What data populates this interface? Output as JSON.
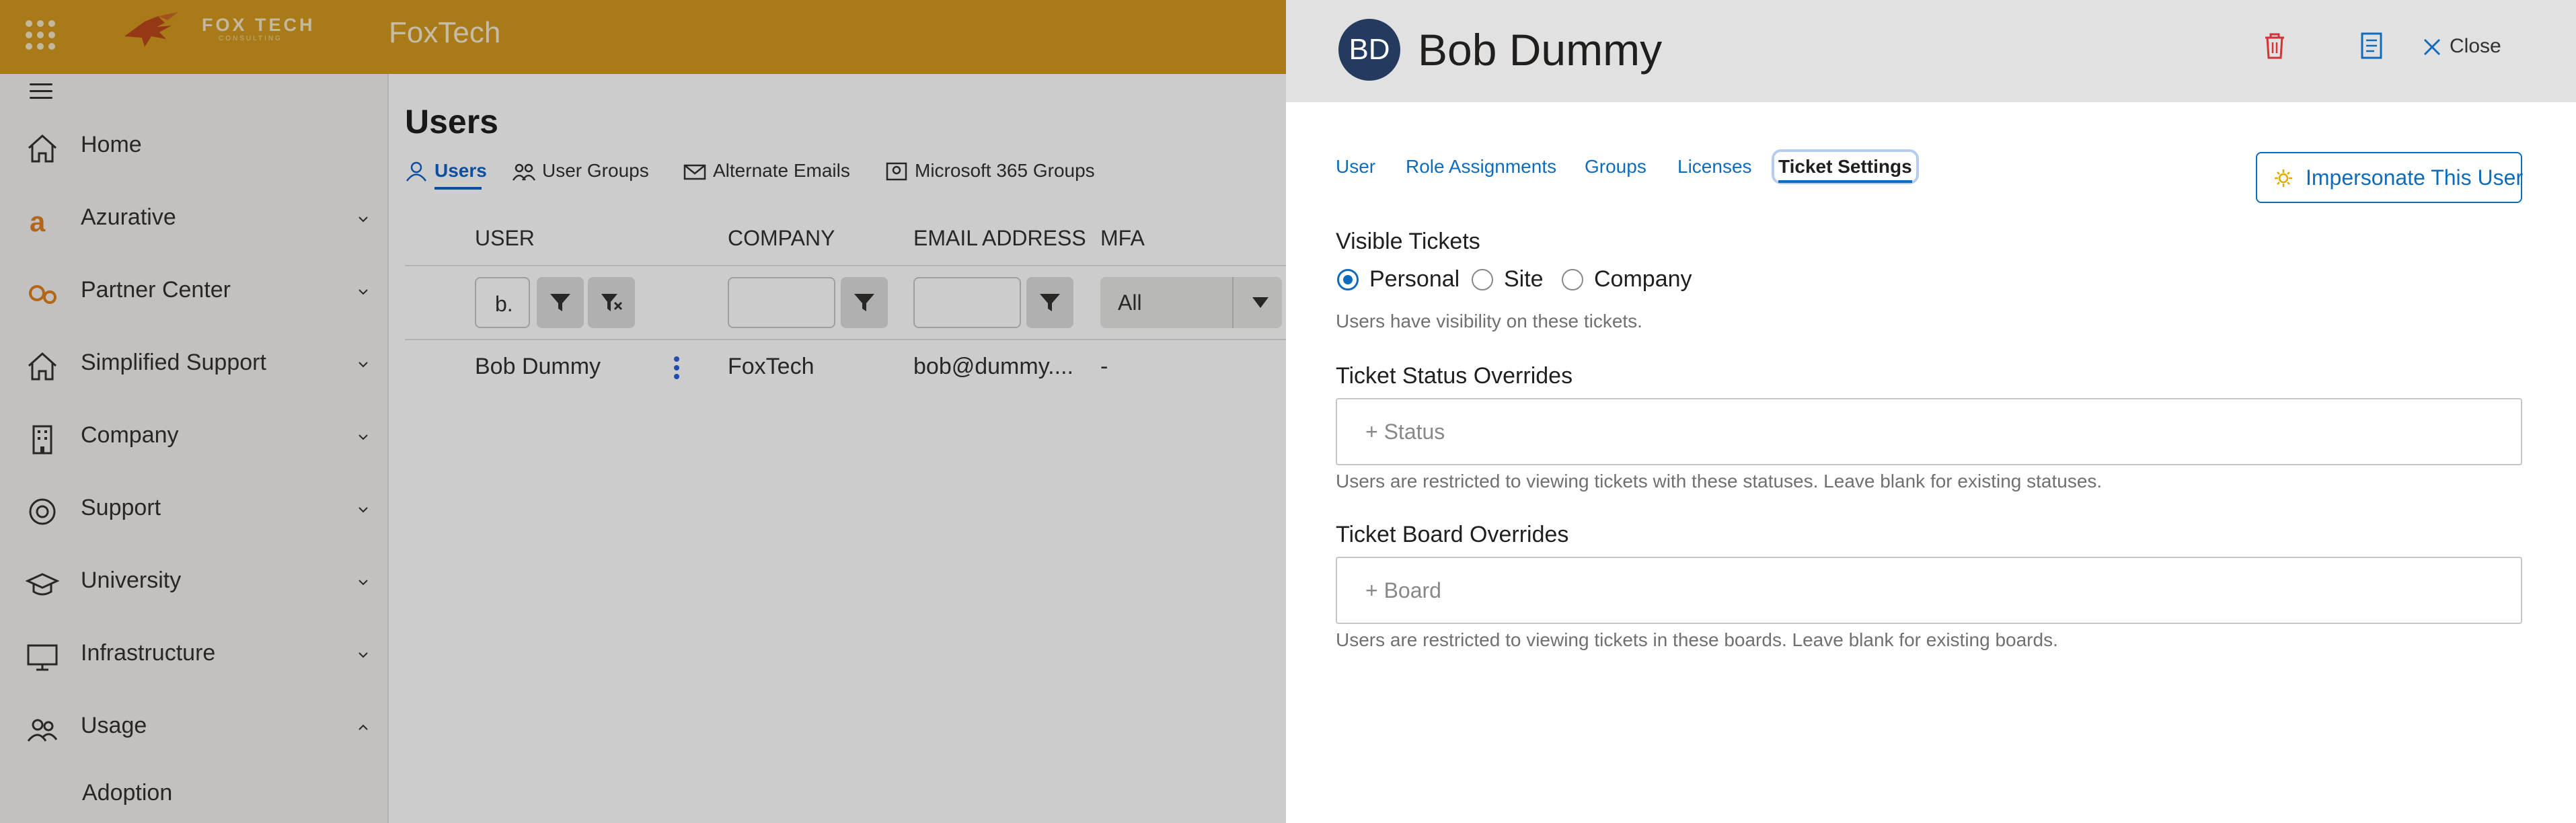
{
  "app": {
    "title": "FoxTech",
    "logo_text": "FOX TECH",
    "logo_subtext": "CONSULTING"
  },
  "sidebar": {
    "items": [
      {
        "label": "Home",
        "icon": "home-icon",
        "expandable": false
      },
      {
        "label": "Azurative",
        "icon": "azurative-icon",
        "expandable": true
      },
      {
        "label": "Partner Center",
        "icon": "gears-icon",
        "expandable": true
      },
      {
        "label": "Simplified Support",
        "icon": "home-icon",
        "expandable": true
      },
      {
        "label": "Company",
        "icon": "building-icon",
        "expandable": true
      },
      {
        "label": "Support",
        "icon": "lifebuoy-icon",
        "expandable": true
      },
      {
        "label": "University",
        "icon": "graduation-cap-icon",
        "expandable": true
      },
      {
        "label": "Infrastructure",
        "icon": "monitor-icon",
        "expandable": true
      },
      {
        "label": "Usage",
        "icon": "people-icon",
        "expandable": true,
        "expanded": true
      }
    ],
    "sub_items": [
      {
        "label": "Adoption"
      }
    ]
  },
  "main": {
    "title": "Users",
    "tabs": [
      {
        "label": "Users",
        "icon": "user-icon",
        "active": true
      },
      {
        "label": "User Groups",
        "icon": "user-group-icon",
        "active": false
      },
      {
        "label": "Alternate Emails",
        "icon": "email-icon",
        "active": false
      },
      {
        "label": "Microsoft 365 Groups",
        "icon": "m365-groups-icon",
        "active": false
      }
    ],
    "columns": [
      "USER",
      "COMPANY",
      "EMAIL ADDRESS",
      "MFA"
    ],
    "filters": {
      "user_value": "b.",
      "company_value": "",
      "email_value": "",
      "mfa_value": "All"
    },
    "rows": [
      {
        "user": "Bob Dummy",
        "company": "FoxTech",
        "email": "bob@dummy....",
        "mfa": "-"
      }
    ]
  },
  "panel": {
    "avatar_initials": "BD",
    "user_name": "Bob Dummy",
    "close_label": "Close",
    "tabs": [
      {
        "label": "User",
        "active": false
      },
      {
        "label": "Role Assignments",
        "active": false
      },
      {
        "label": "Groups",
        "active": false
      },
      {
        "label": "Licenses",
        "active": false
      },
      {
        "label": "Ticket Settings",
        "active": true
      }
    ],
    "impersonate_label": "Impersonate This User",
    "visible_tickets": {
      "label": "Visible Tickets",
      "options": [
        "Personal",
        "Site",
        "Company"
      ],
      "selected": "Personal",
      "hint": "Users have visibility on these tickets."
    },
    "status_overrides": {
      "label": "Ticket Status Overrides",
      "placeholder": "+ Status",
      "hint": "Users are restricted to viewing tickets with these statuses. Leave blank for existing statuses."
    },
    "board_overrides": {
      "label": "Ticket Board Overrides",
      "placeholder": "+ Board",
      "hint": "Users are restricted to viewing tickets in these boards. Leave blank for existing boards."
    }
  },
  "colors": {
    "header": "#d49a1e",
    "accent": "#0f6cbd",
    "delete": "#d13438"
  }
}
